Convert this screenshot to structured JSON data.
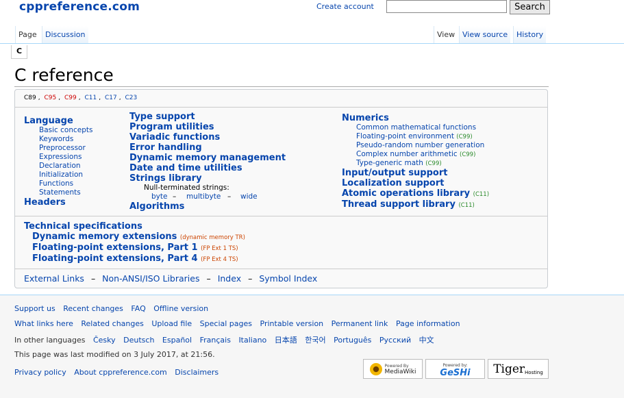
{
  "header": {
    "logo": "cppreference.com",
    "create_account": "Create account",
    "search_button": "Search",
    "search_value": ""
  },
  "tabs": {
    "left": [
      "Page",
      "Discussion"
    ],
    "right": [
      "View",
      "View source",
      "History"
    ]
  },
  "breadcrumb": "C",
  "page_title": "C reference",
  "standards": [
    {
      "label": "C89",
      "color": "#000000"
    },
    {
      "label": "C95",
      "color": "#cc0000"
    },
    {
      "label": "C99",
      "color": "#cc0000"
    },
    {
      "label": "C11",
      "color": "#0645ad"
    },
    {
      "label": "C17",
      "color": "#0645ad"
    },
    {
      "label": "C23",
      "color": "#0645ad"
    }
  ],
  "col1": {
    "language": "Language",
    "items": [
      "Basic concepts",
      "Keywords",
      "Preprocessor",
      "Expressions",
      "Declaration",
      "Initialization",
      "Functions",
      "Statements"
    ],
    "headers": "Headers"
  },
  "col2": {
    "items": [
      "Type support",
      "Program utilities",
      "Variadic functions",
      "Error handling",
      "Dynamic memory management",
      "Date and time utilities",
      "Strings library"
    ],
    "null_term": "Null-terminated strings:",
    "byte": "byte",
    "multibyte": "multibyte",
    "wide": "wide",
    "dash": "–",
    "algorithms": "Algorithms"
  },
  "col3": {
    "numerics": "Numerics",
    "num_items": [
      {
        "label": "Common mathematical functions",
        "tag": ""
      },
      {
        "label": "Floating-point environment",
        "tag": "(C99)"
      },
      {
        "label": "Pseudo-random number generation",
        "tag": ""
      },
      {
        "label": "Complex number arithmetic",
        "tag": "(C99)"
      },
      {
        "label": "Type-generic math",
        "tag": "(C99)"
      }
    ],
    "io": "Input/output support",
    "loc": "Localization support",
    "atomic": "Atomic operations library",
    "atomic_tag": "(C11)",
    "thread": "Thread support library",
    "thread_tag": "(C11)"
  },
  "tech": {
    "title": "Technical specifications",
    "items": [
      {
        "label": "Dynamic memory extensions",
        "tag": "(dynamic memory TR)"
      },
      {
        "label": "Floating-point extensions, Part 1",
        "tag": "(FP Ext 1 TS)"
      },
      {
        "label": "Floating-point extensions, Part 4",
        "tag": "(FP Ext 4 TS)"
      }
    ]
  },
  "bottom_links": [
    "External Links",
    "Non-ANSI/ISO Libraries",
    "Index",
    "Symbol Index"
  ],
  "bottom_sep": "–",
  "footer": {
    "row1": [
      "Support us",
      "Recent changes",
      "FAQ",
      "Offline version"
    ],
    "row2": [
      "What links here",
      "Related changes",
      "Upload file",
      "Special pages",
      "Printable version",
      "Permanent link",
      "Page information"
    ],
    "lang_label": "In other languages",
    "languages": [
      "Česky",
      "Deutsch",
      "Español",
      "Français",
      "Italiano",
      "日本語",
      "한국어",
      "Português",
      "Русский",
      "中文"
    ],
    "modified": "This page was last modified on 3 July 2017, at 21:56.",
    "row5": [
      "Privacy policy",
      "About cppreference.com",
      "Disclaimers"
    ],
    "badges": {
      "mediawiki_top": "Powered By",
      "mediawiki": "MediaWiki",
      "geshi_top": "Powered by:",
      "geshi": "GeSHi",
      "tiger": "Tiger",
      "tiger_sub": "Hosting"
    }
  }
}
